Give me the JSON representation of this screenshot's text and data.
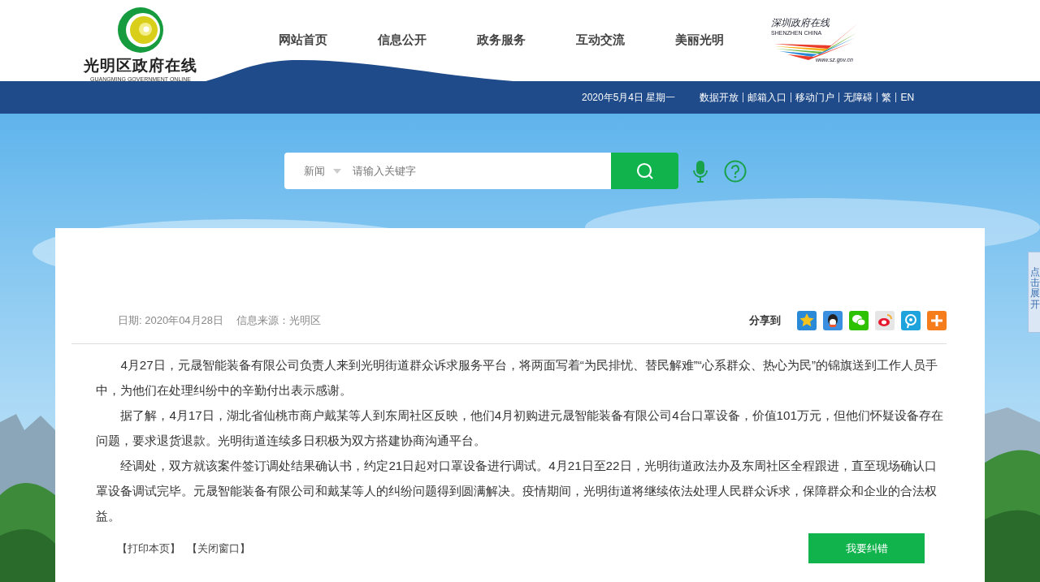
{
  "logo": {
    "title": "光明区政府在线",
    "subtitle": "GUANGMING GOVERNMENT ONLINE"
  },
  "nav": [
    {
      "label": "网站首页"
    },
    {
      "label": "信息公开"
    },
    {
      "label": "政务服务"
    },
    {
      "label": "互动交流"
    },
    {
      "label": "美丽光明"
    }
  ],
  "partner_logo": {
    "title": "深圳政府在线",
    "subtitle": "SHENZHEN CHINA",
    "url": "www.sz.gov.cn"
  },
  "top_bar": {
    "date": "2020年5月4日 星期一",
    "links": [
      "数据开放",
      "邮箱入口",
      "移动门户",
      "无障碍",
      "繁",
      "EN"
    ]
  },
  "search": {
    "category": "新闻",
    "placeholder": "请输入关键字"
  },
  "side_tab": {
    "label": "点击展开"
  },
  "article": {
    "date": "日期: 2020年04月28日",
    "source": "信息来源：光明区",
    "share_label": "分享到",
    "paragraphs": [
      "4月27日，元晟智能装备有限公司负责人来到光明街道群众诉求服务平台，将两面写着“为民排忧、替民解难”“心系群众、热心为民”的锦旗送到工作人员手中，为他们在处理纠纷中的辛勤付出表示感谢。",
      "据了解，4月17日，湖北省仙桃市商户戴某等人到东周社区反映，他们4月初购进元晟智能装备有限公司4台口罩设备，价值101万元，但他们怀疑设备存在问题，要求退货退款。光明街道连续多日积极为双方搭建协商沟通平台。",
      "经调处，双方就该案件签订调处结果确认书，约定21日起对口罩设备进行调试。4月21日至22日，光明街道政法办及东周社区全程跟进，直至现场确认口罩设备调试完毕。元晟智能装备有限公司和戴某等人的纠纷问题得到圆满解决。疫情期间，光明街道将继续依法处理人民群众诉求，保障群众和企业的合法权益。"
    ],
    "actions": [
      "【打印本页】",
      "【关闭窗口】"
    ],
    "report_button": "我要纠错"
  }
}
